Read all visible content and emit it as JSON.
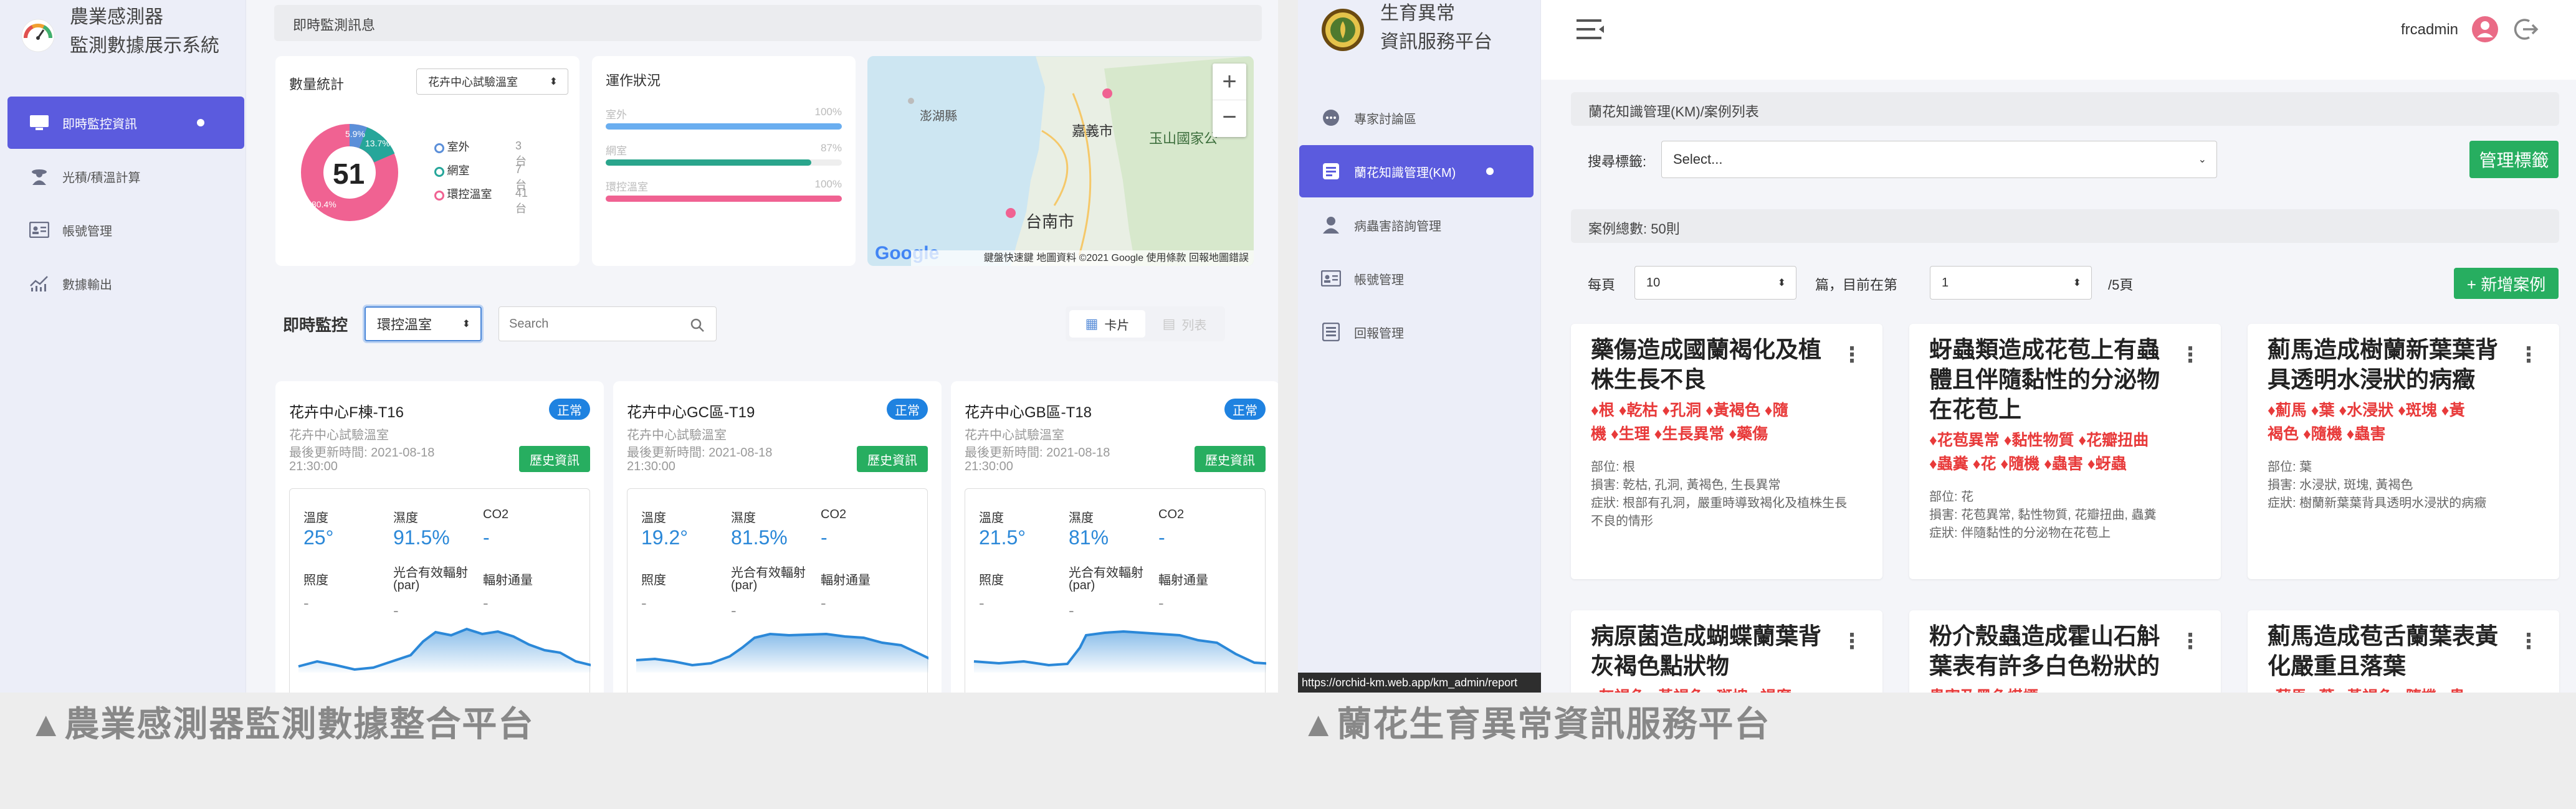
{
  "captions": {
    "left": "▲農業感測器監測數據整合平台",
    "right": "▲蘭花生育異常資訊服務平台"
  },
  "app1": {
    "title_line1": "農業感測器",
    "title_line2": "監測數據展示系統",
    "nav": [
      {
        "label": "即時監控資訊"
      },
      {
        "label": "光積/積溫計算"
      },
      {
        "label": "帳號管理"
      },
      {
        "label": "數據輸出"
      }
    ],
    "header": "即時監測訊息",
    "stats": {
      "title": "數量統計",
      "select": "花卉中心試驗溫室",
      "total": "51",
      "pct_a": "5.9%",
      "pct_b": "13.7%",
      "pct_c": "80.4%",
      "legend": [
        {
          "label": "室外",
          "count": "3台"
        },
        {
          "label": "網室",
          "count": "7台"
        },
        {
          "label": "環控溫室",
          "count": "41台"
        }
      ]
    },
    "ops": {
      "title": "運作狀況",
      "rows": [
        {
          "label": "室外",
          "pct": "100%",
          "value": 1.0,
          "color": "#6aaef0"
        },
        {
          "label": "網室",
          "pct": "87%",
          "value": 0.87,
          "color": "#2aa58c"
        },
        {
          "label": "環控溫室",
          "pct": "100%",
          "value": 1.0,
          "color": "#f06292"
        }
      ]
    },
    "map": {
      "labels": [
        "澎湖縣",
        "嘉義市",
        "玉山國家公",
        "台南市"
      ],
      "footer": "鍵盤快速鍵  地圖資料 ©2021 Google  使用條款  回報地圖錯誤",
      "google": "Google",
      "zoom_in": "+",
      "zoom_out": "−"
    },
    "monitor": {
      "title": "即時監控",
      "select": "環控溫室",
      "search_placeholder": "Search",
      "view_card": "卡片",
      "view_list": "列表"
    },
    "sensors": [
      {
        "name": "花卉中心F棟-T16",
        "status": "正常",
        "sub": "花卉中心試驗溫室",
        "updated": "最後更新時間: 2021-08-18",
        "time": "21:30:00",
        "history": "歷史資訊",
        "temp": "25°",
        "hum": "91.5%",
        "co2": "-",
        "lux": "-",
        "par": "-",
        "rad": "-"
      },
      {
        "name": "花卉中心GC區-T19",
        "status": "正常",
        "sub": "花卉中心試驗溫室",
        "updated": "最後更新時間: 2021-08-18",
        "time": "21:30:00",
        "history": "歷史資訊",
        "temp": "19.2°",
        "hum": "81.5%",
        "co2": "-",
        "lux": "-",
        "par": "-",
        "rad": "-"
      },
      {
        "name": "花卉中心GB區-T18",
        "status": "正常",
        "sub": "花卉中心試驗溫室",
        "updated": "最後更新時間: 2021-08-18",
        "time": "21:30:00",
        "history": "歷史資訊",
        "temp": "21.5°",
        "hum": "81%",
        "co2": "-",
        "lux": "-",
        "par": "-",
        "rad": "-"
      }
    ],
    "metric_labels": {
      "temp": "溫度",
      "hum": "濕度",
      "co2": "CO2",
      "lux": "照度",
      "par1": "光合有效輻射",
      "par2": "(par)",
      "rad": "輻射通量"
    }
  },
  "app2": {
    "title_line1": "生育異常",
    "title_line2": "資訊服務平台",
    "user": "frcadmin",
    "nav": [
      {
        "label": "專家討論區"
      },
      {
        "label": "蘭花知識管理(KM)"
      },
      {
        "label": "病蟲害諮詢管理"
      },
      {
        "label": "帳號管理"
      },
      {
        "label": "回報管理"
      }
    ],
    "breadcrumb": "蘭花知識管理(KM)/案例列表",
    "search_label": "搜尋標籤:",
    "search_select": "Select...",
    "manage_tags": "管理標籤",
    "total": "案例總數: 50則",
    "per_page_label": "每頁",
    "per_page": "10",
    "page_label": "篇，目前在第",
    "page": "1",
    "page_total": "/5頁",
    "add_case": "+ 新增案例",
    "status_url": "https://orchid-km.web.app/km_admin/report",
    "cases": [
      {
        "title1": "藥傷造成國蘭褐化及植",
        "title2": "株生長不良",
        "tags1": "♦根 ♦乾枯 ♦孔洞 ♦黃褐色 ♦隨",
        "tags2": "機 ♦生理 ♦生長異常 ♦藥傷",
        "m1": "部位: 根",
        "m2": "損害: 乾枯, 孔洞, 黃褐色, 生長異常",
        "m3": "症狀: 根部有孔洞，嚴重時導致褐化及植株生長",
        "m4": "不良的情形"
      },
      {
        "title1": "蚜蟲類造成花苞上有蟲",
        "title2": "體且伴隨黏性的分泌物",
        "title3": "在花苞上",
        "tags1": "♦花苞異常 ♦黏性物質 ♦花瓣扭曲",
        "tags2": "♦蟲糞 ♦花 ♦隨機 ♦蟲害 ♦蚜蟲",
        "m1": "部位: 花",
        "m2": "損害: 花苞異常, 黏性物質, 花瓣扭曲, 蟲糞",
        "m3": "症狀: 伴隨黏性的分泌物在花苞上"
      },
      {
        "title1": "薊馬造成樹蘭新葉葉背",
        "title2": "具透明水浸狀的病癥",
        "tags1": "♦薊馬 ♦葉 ♦水浸狀 ♦斑塊 ♦黃",
        "tags2": "褐色 ♦隨機 ♦蟲害",
        "m1": "部位: 葉",
        "m2": "損害: 水浸狀, 斑塊, 黃褐色",
        "m3": "症狀: 樹蘭新葉葉背具透明水浸狀的病癥"
      },
      {
        "title1": "病原菌造成蝴蝶蘭葉背",
        "title2": "灰褐色點狀物",
        "tags1": "♦灰褐色 ♦黃褐色 ♦斑塊 ♦褐腐"
      },
      {
        "title1": "粉介殼蟲造成霍山石斛",
        "title2": "葉表有許多白色粉狀的",
        "tags1": "蟲害及黑色煤煙"
      },
      {
        "title1": "薊馬造成苞舌蘭葉表黃",
        "title2": "化嚴重且落葉",
        "tags1": "♦薊馬 ♦葉 ♦黃褐色 ♦隨機 ♦蟲"
      }
    ]
  }
}
